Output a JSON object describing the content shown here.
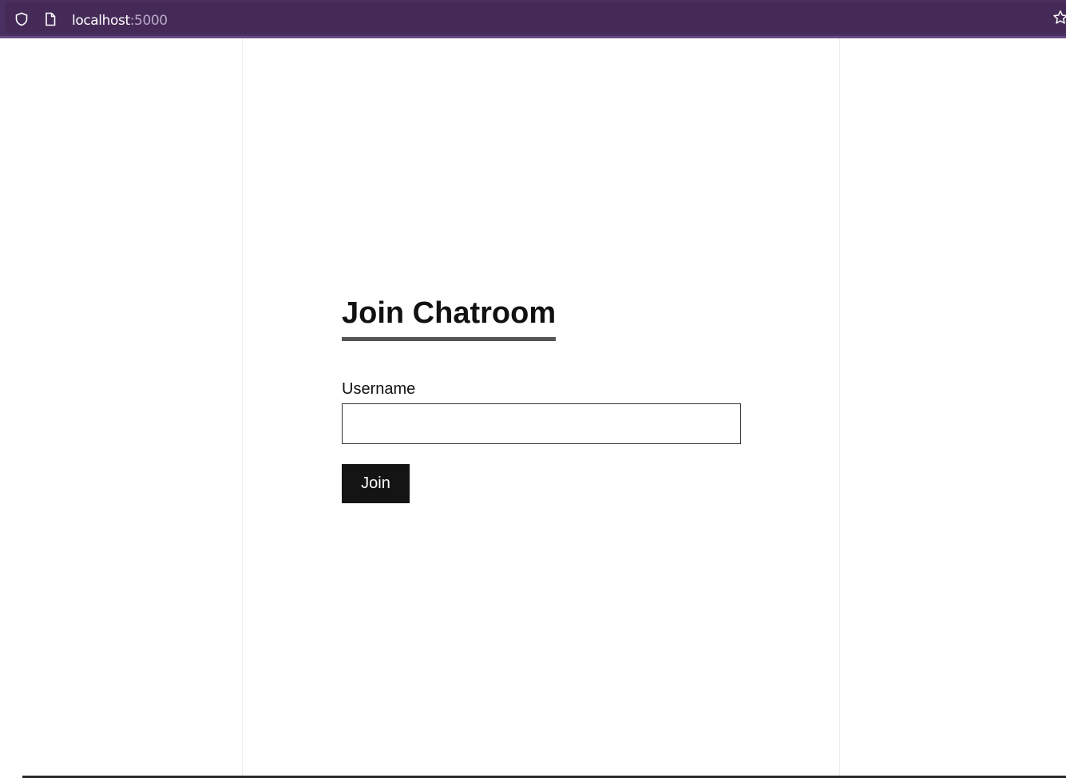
{
  "browser": {
    "url_host": "localhost",
    "url_port": ":5000",
    "icons": [
      "shield-icon",
      "page-icon",
      "star-icon"
    ]
  },
  "form": {
    "title": "Join Chatroom",
    "username_label": "Username",
    "username_value": "",
    "join_label": "Join"
  },
  "colors": {
    "toolbar": "#4a3060",
    "button": "#141414",
    "title_underline": "#555555"
  }
}
